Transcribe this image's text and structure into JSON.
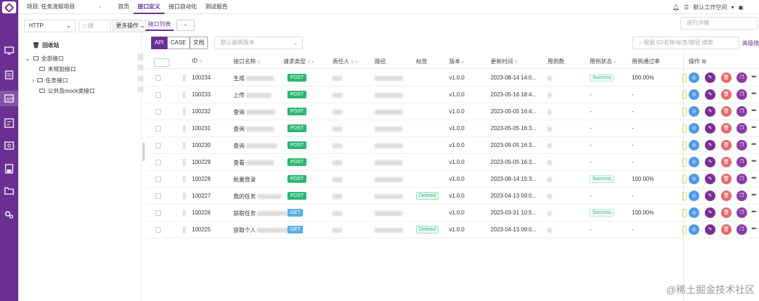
{
  "topbar": {
    "project_label": "项目: 任务流程项目",
    "nav": [
      "首页",
      "接口定义",
      "接口自动化",
      "测试报告"
    ],
    "workspace": "默认工作空间"
  },
  "tree": {
    "protocol": "HTTP",
    "filter_placeholder": "搜",
    "more_ops": "更多操作",
    "recycle": "回收站",
    "all": "全部接口",
    "unplanned": "未规划接口",
    "task": "任务接口",
    "common": "公共及mock类接口"
  },
  "main": {
    "tab_active": "接口列表",
    "tab_add": "+",
    "jump_placeholder": "进行详情",
    "view_api": "API",
    "view_case": "CASE",
    "view_doc": "文档",
    "version_placeholder": "默认最新版本",
    "search_placeholder": "根据 ID/名称/标签/路径 搜索",
    "advanced": "高级搜"
  },
  "table": {
    "headers": [
      "ID",
      "接口名称",
      "请求类型",
      "责任人",
      "路径",
      "标签",
      "版本",
      "更新时间",
      "用例数",
      "用例状态",
      "用例通过率",
      "操作"
    ],
    "rows": [
      {
        "id": "100234",
        "name": "生成",
        "method": "POST",
        "tag": "",
        "version": "v1.0.0",
        "updated": "2023-08-14 14:0...",
        "status": "Success",
        "rate": "100.00%"
      },
      {
        "id": "100233",
        "name": "上传",
        "method": "POST",
        "tag": "",
        "version": "v1.0.0",
        "updated": "2023-05-16 18:4...",
        "status": "-",
        "rate": "-"
      },
      {
        "id": "100232",
        "name": "查询",
        "method": "POST",
        "tag": "",
        "version": "v1.0.0",
        "updated": "2023-05-05 16:4...",
        "status": "-",
        "rate": "-"
      },
      {
        "id": "100231",
        "name": "查询",
        "method": "POST",
        "tag": "",
        "version": "v1.0.0",
        "updated": "2023-05-05 16:3...",
        "status": "-",
        "rate": "-"
      },
      {
        "id": "100230",
        "name": "查询",
        "method": "POST",
        "tag": "",
        "version": "v1.0.0",
        "updated": "2023-05-05 16:3...",
        "status": "-",
        "rate": "-"
      },
      {
        "id": "100229",
        "name": "查看",
        "method": "POST",
        "tag": "",
        "version": "v1.0.0",
        "updated": "2023-05-05 16:3...",
        "status": "-",
        "rate": "-"
      },
      {
        "id": "100228",
        "name": "批量登录",
        "method": "POST",
        "tag": "",
        "version": "v1.0.0",
        "updated": "2023-08-14 15:3...",
        "status": "Success",
        "rate": "100.00%"
      },
      {
        "id": "100227",
        "name": "我的任务",
        "method": "POST",
        "tag": "Deleted",
        "version": "v1.0.0",
        "updated": "2023-04-13 09:0...",
        "status": "-",
        "rate": "-"
      },
      {
        "id": "100226",
        "name": "获取任务",
        "method": "GET",
        "tag": "",
        "version": "v1.0.0",
        "updated": "2023-03-31 10:5...",
        "status": "Success",
        "rate": "100.00%"
      },
      {
        "id": "100225",
        "name": "获取个人",
        "method": "GET",
        "tag": "Deleted",
        "version": "v1.0.0",
        "updated": "2023-04-13 09:0...",
        "status": "-",
        "rate": "-"
      }
    ]
  },
  "watermark": "@稀土掘金技术社区",
  "colors": {
    "brand": "#6b2f93",
    "post": "#2bb673",
    "get": "#5aaee8"
  }
}
